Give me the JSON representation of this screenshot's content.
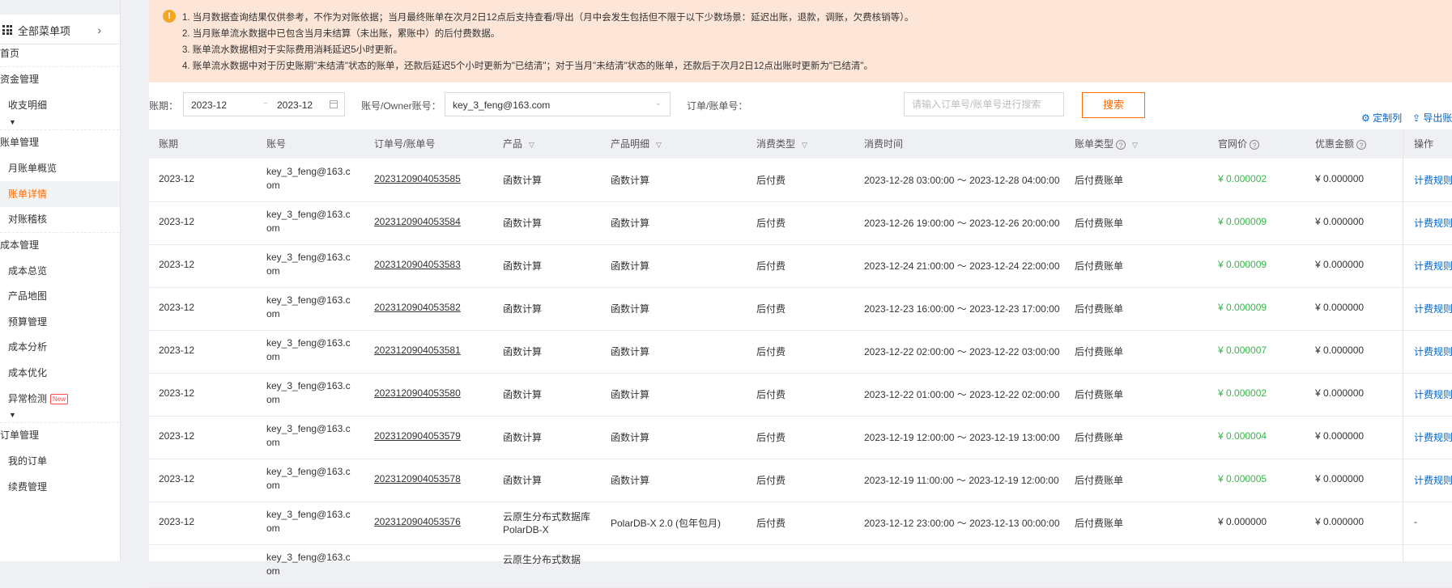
{
  "sidebar": {
    "all_menu": "全部菜单项",
    "items": [
      {
        "label": "首页",
        "kind": "group"
      },
      {
        "label": "资金管理",
        "kind": "group"
      },
      {
        "label": "收支明细",
        "kind": "sub"
      },
      {
        "label": "账单管理",
        "kind": "group"
      },
      {
        "label": "月账单概览",
        "kind": "sub"
      },
      {
        "label": "账单详情",
        "kind": "sub",
        "active": true
      },
      {
        "label": "对账稽核",
        "kind": "sub"
      },
      {
        "label": "成本管理",
        "kind": "group"
      },
      {
        "label": "成本总览",
        "kind": "sub"
      },
      {
        "label": "产品地图",
        "kind": "sub"
      },
      {
        "label": "预算管理",
        "kind": "sub"
      },
      {
        "label": "成本分析",
        "kind": "sub"
      },
      {
        "label": "成本优化",
        "kind": "sub"
      },
      {
        "label": "异常检测",
        "kind": "sub",
        "badge": "New"
      },
      {
        "label": "订单管理",
        "kind": "group"
      },
      {
        "label": "我的订单",
        "kind": "sub"
      },
      {
        "label": "续费管理",
        "kind": "sub"
      }
    ]
  },
  "notice": {
    "icon": "!",
    "lines": [
      "1. 当月数据查询结果仅供参考，不作为对账依据；当月最终账单在次月2日12点后支持查看/导出（月中会发生包括但不限于以下少数场景：延迟出账，退款，调账，欠费核销等）。",
      "2. 当月账单流水数据中已包含当月未结算（未出账，累账中）的后付费数据。",
      "3. 账单流水数据相对于实际费用消耗延迟5小时更新。",
      "4. 账单流水数据中对于历史账期\"未结清\"状态的账单，还款后延迟5个小时更新为\"已结清\"；对于当月\"未结清\"状态的账单，还款后于次月2日12点出账时更新为\"已结清\"。"
    ]
  },
  "filters": {
    "period_label": "账期：",
    "period_start": "2023-12",
    "period_separator": "~",
    "period_end": "2023-12",
    "account_label": "账号/Owner账号：",
    "account_value": "key_3_feng@163.com",
    "order_label": "订单/账单号：",
    "order_placeholder": "请输入订单号/账单号进行搜索",
    "search_button": "搜索"
  },
  "toolbar": {
    "customize": "定制列",
    "export": "导出账"
  },
  "table": {
    "columns": [
      {
        "label": "账期"
      },
      {
        "label": "账号"
      },
      {
        "label": "订单号/账单号"
      },
      {
        "label": "产品",
        "filter": true
      },
      {
        "label": "产品明细",
        "filter": true
      },
      {
        "label": "消费类型",
        "filter": true
      },
      {
        "label": "消费时间"
      },
      {
        "label": "账单类型",
        "help": true,
        "filter": true
      },
      {
        "label": "官网价",
        "help": true
      },
      {
        "label": "优惠金额",
        "help": true
      },
      {
        "label": "操作"
      }
    ],
    "rows": [
      {
        "period": "2023-12",
        "account": "key_3_feng@163.com",
        "order": "2023120904053585",
        "product": "函数计算",
        "detail": "函数计算",
        "consume_type": "后付费",
        "time": "2023-12-28 03:00:00 ～ 2023-12-28 04:00:00",
        "bill_type": "后付费账单",
        "price": "¥ 0.000002",
        "discount": "¥ 0.000000",
        "action": "计费规则"
      },
      {
        "period": "2023-12",
        "account": "key_3_feng@163.com",
        "order": "2023120904053584",
        "product": "函数计算",
        "detail": "函数计算",
        "consume_type": "后付费",
        "time": "2023-12-26 19:00:00 ～ 2023-12-26 20:00:00",
        "bill_type": "后付费账单",
        "price": "¥ 0.000009",
        "discount": "¥ 0.000000",
        "action": "计费规则"
      },
      {
        "period": "2023-12",
        "account": "key_3_feng@163.com",
        "order": "2023120904053583",
        "product": "函数计算",
        "detail": "函数计算",
        "consume_type": "后付费",
        "time": "2023-12-24 21:00:00 ～ 2023-12-24 22:00:00",
        "bill_type": "后付费账单",
        "price": "¥ 0.000009",
        "discount": "¥ 0.000000",
        "action": "计费规则"
      },
      {
        "period": "2023-12",
        "account": "key_3_feng@163.com",
        "order": "2023120904053582",
        "product": "函数计算",
        "detail": "函数计算",
        "consume_type": "后付费",
        "time": "2023-12-23 16:00:00 ～ 2023-12-23 17:00:00",
        "bill_type": "后付费账单",
        "price": "¥ 0.000009",
        "discount": "¥ 0.000000",
        "action": "计费规则"
      },
      {
        "period": "2023-12",
        "account": "key_3_feng@163.com",
        "order": "2023120904053581",
        "product": "函数计算",
        "detail": "函数计算",
        "consume_type": "后付费",
        "time": "2023-12-22 02:00:00 ～ 2023-12-22 03:00:00",
        "bill_type": "后付费账单",
        "price": "¥ 0.000007",
        "discount": "¥ 0.000000",
        "action": "计费规则"
      },
      {
        "period": "2023-12",
        "account": "key_3_feng@163.com",
        "order": "2023120904053580",
        "product": "函数计算",
        "detail": "函数计算",
        "consume_type": "后付费",
        "time": "2023-12-22 01:00:00 ～ 2023-12-22 02:00:00",
        "bill_type": "后付费账单",
        "price": "¥ 0.000002",
        "discount": "¥ 0.000000",
        "action": "计费规则"
      },
      {
        "period": "2023-12",
        "account": "key_3_feng@163.com",
        "order": "2023120904053579",
        "product": "函数计算",
        "detail": "函数计算",
        "consume_type": "后付费",
        "time": "2023-12-19 12:00:00 ～ 2023-12-19 13:00:00",
        "bill_type": "后付费账单",
        "price": "¥ 0.000004",
        "discount": "¥ 0.000000",
        "action": "计费规则"
      },
      {
        "period": "2023-12",
        "account": "key_3_feng@163.com",
        "order": "2023120904053578",
        "product": "函数计算",
        "detail": "函数计算",
        "consume_type": "后付费",
        "time": "2023-12-19 11:00:00 ～ 2023-12-19 12:00:00",
        "bill_type": "后付费账单",
        "price": "¥ 0.000005",
        "discount": "¥ 0.000000",
        "action": "计费规则"
      },
      {
        "period": "2023-12",
        "account": "key_3_feng@163.com",
        "order": "2023120904053576",
        "product": "云原生分布式数据库 PolarDB-X",
        "detail": "PolarDB-X 2.0 (包年包月)",
        "consume_type": "后付费",
        "time": "2023-12-12 23:00:00 ～ 2023-12-13 00:00:00",
        "bill_type": "后付费账单",
        "price": "¥ 0.000000",
        "discount": "¥ 0.000000",
        "action": "-"
      },
      {
        "period": "",
        "account": "key_3_feng@163.com",
        "order": "",
        "product": "云原生分布式数据",
        "detail": "",
        "consume_type": "",
        "time": "",
        "bill_type": "",
        "price": "",
        "discount": "",
        "action": ""
      }
    ]
  },
  "colors": {
    "accent": "#ff6a00",
    "link": "#0064c8",
    "price_green": "#39b54a",
    "notice_bg": "#fde6d8"
  },
  "icons": {
    "menu_grid": "grid-icon",
    "chevron": "chevron-right-icon",
    "info": "info-icon",
    "calendar": "calendar-icon",
    "dropdown": "chevron-down-icon",
    "settings": "gear-icon",
    "export": "export-icon",
    "filter": "filter-icon",
    "help": "help-icon"
  }
}
